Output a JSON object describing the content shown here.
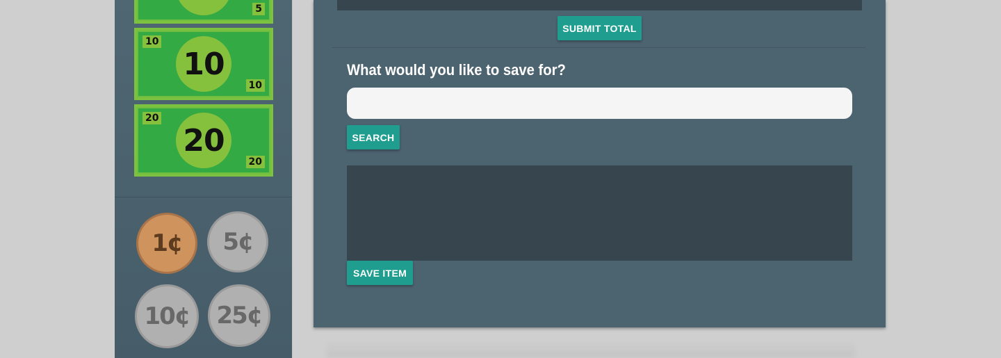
{
  "bills": [
    {
      "corner_tl": "",
      "center": "",
      "corner_br": "5"
    },
    {
      "corner_tl": "10",
      "center": "10",
      "corner_br": "10"
    },
    {
      "corner_tl": "20",
      "center": "20",
      "corner_br": "20"
    }
  ],
  "coins": [
    {
      "label": "1¢",
      "kind": "penny"
    },
    {
      "label": "5¢",
      "kind": "nickel"
    },
    {
      "label": "10¢",
      "kind": "dime"
    },
    {
      "label": "25¢",
      "kind": "quarter"
    }
  ],
  "panel": {
    "submit_label": "SUBMIT TOTAL",
    "question": "What would you like to save for?",
    "search_value": "",
    "search_label": "SEARCH",
    "save_label": "SAVE ITEM"
  },
  "colors": {
    "accent": "#1f9e8f",
    "panel": "#4c6370",
    "sidebar": "#4f6673",
    "bill_green": "#33aa44"
  }
}
